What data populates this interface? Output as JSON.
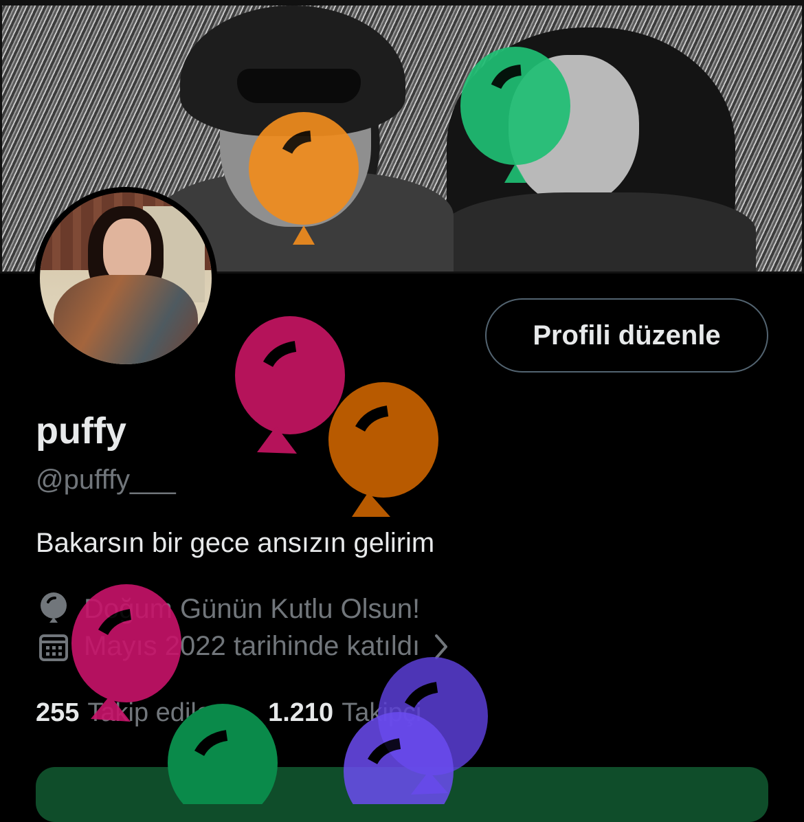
{
  "profile": {
    "edit_button": "Profili düzenle",
    "name": "puffy",
    "handle": "@pufffy___",
    "bio": "Bakarsın bir gece ansızın gelirim",
    "birthday_text": "Doğum Günün Kutlu Olsun!",
    "joined_text": "Mayıs 2022 tarihinde katıldı",
    "following_count": "255",
    "following_label": "Takip edilen",
    "followers_count": "1.210",
    "followers_label": "Takipçi"
  },
  "icons": {
    "birthday": "balloon-icon",
    "joined": "calendar-icon",
    "more": "chevron-right-icon"
  },
  "colors": {
    "background": "#000000",
    "text_primary": "#e7e9ea",
    "text_secondary": "#71767b",
    "button_border": "#536471",
    "balloon_orange": "#f08c1e",
    "balloon_green": "#1fbf74",
    "balloon_magenta": "#b5135a",
    "balloon_rust": "#b85a00",
    "balloon_pink": "#c8136a",
    "balloon_teal": "#0a8a4a",
    "balloon_purple": "#5b3fd6",
    "balloon_violet": "#6b4cf0",
    "bottom_bar": "#0f4d2a"
  }
}
